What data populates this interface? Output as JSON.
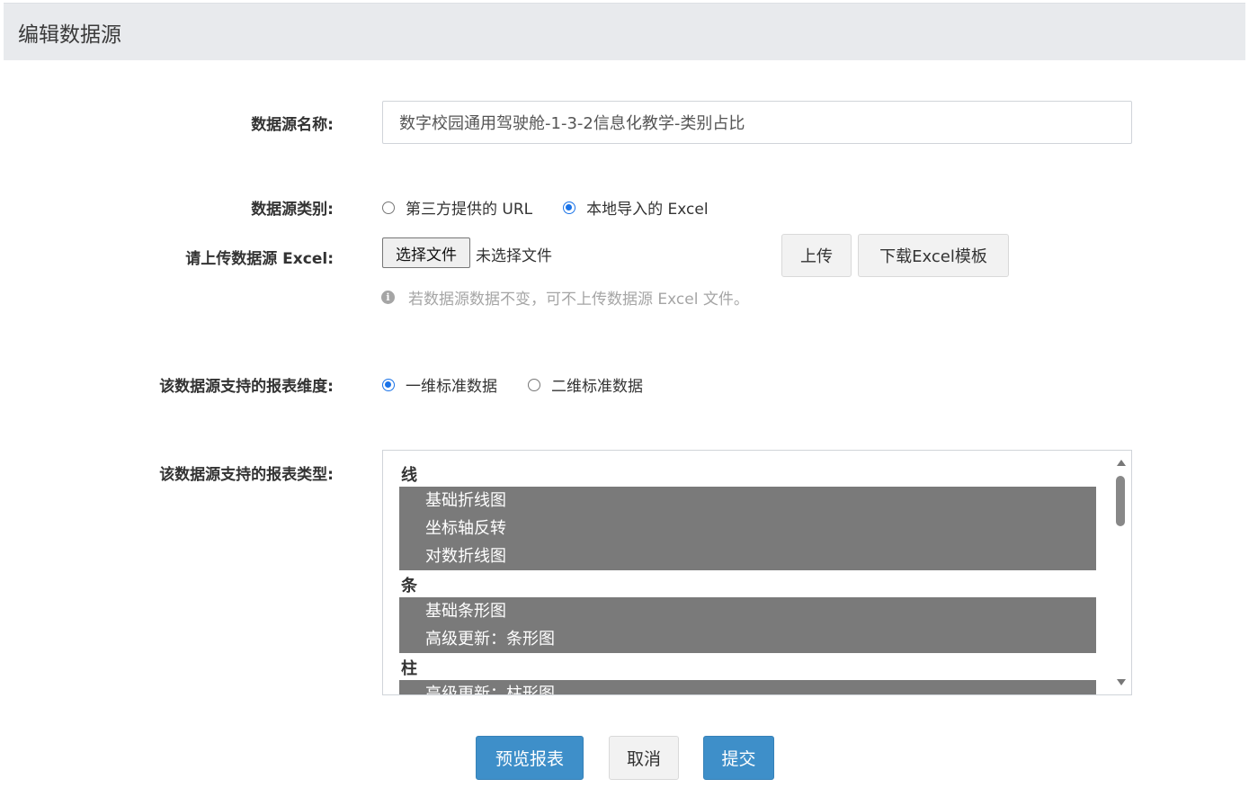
{
  "panel": {
    "title": "编辑数据源"
  },
  "form": {
    "name": {
      "label": "数据源名称:",
      "value": "数字校园通用驾驶舱-1-3-2信息化教学-类别占比"
    },
    "category": {
      "label": "数据源类别:",
      "options": [
        {
          "label": "第三方提供的 URL",
          "checked": false
        },
        {
          "label": "本地导入的 Excel",
          "checked": true
        }
      ]
    },
    "upload": {
      "label": "请上传数据源 Excel:",
      "choose_label": "选择文件",
      "status": "未选择文件",
      "upload_label": "上传",
      "template_label": "下载Excel模板",
      "hint": "若数据源数据不变，可不上传数据源 Excel 文件。",
      "hint_icon": "info-circle-icon"
    },
    "dimension": {
      "label": "该数据源支持的报表维度:",
      "options": [
        {
          "label": "一维标准数据",
          "checked": true
        },
        {
          "label": "二维标准数据",
          "checked": false
        }
      ]
    },
    "chart_types": {
      "label": "该数据源支持的报表类型:",
      "groups": [
        {
          "label": "线",
          "options": [
            "基础折线图",
            "坐标轴反转",
            "对数折线图"
          ]
        },
        {
          "label": "条",
          "options": [
            "基础条形图",
            "高级更新：条形图"
          ]
        },
        {
          "label": "柱",
          "options": [
            "高级更新：柱形图"
          ]
        }
      ]
    }
  },
  "actions": {
    "preview": "预览报表",
    "cancel": "取消",
    "submit": "提交"
  },
  "colors": {
    "primary": "#3e8fc9",
    "selected_option": "#7a7a7a",
    "radio_checked": "#1a73e8"
  }
}
